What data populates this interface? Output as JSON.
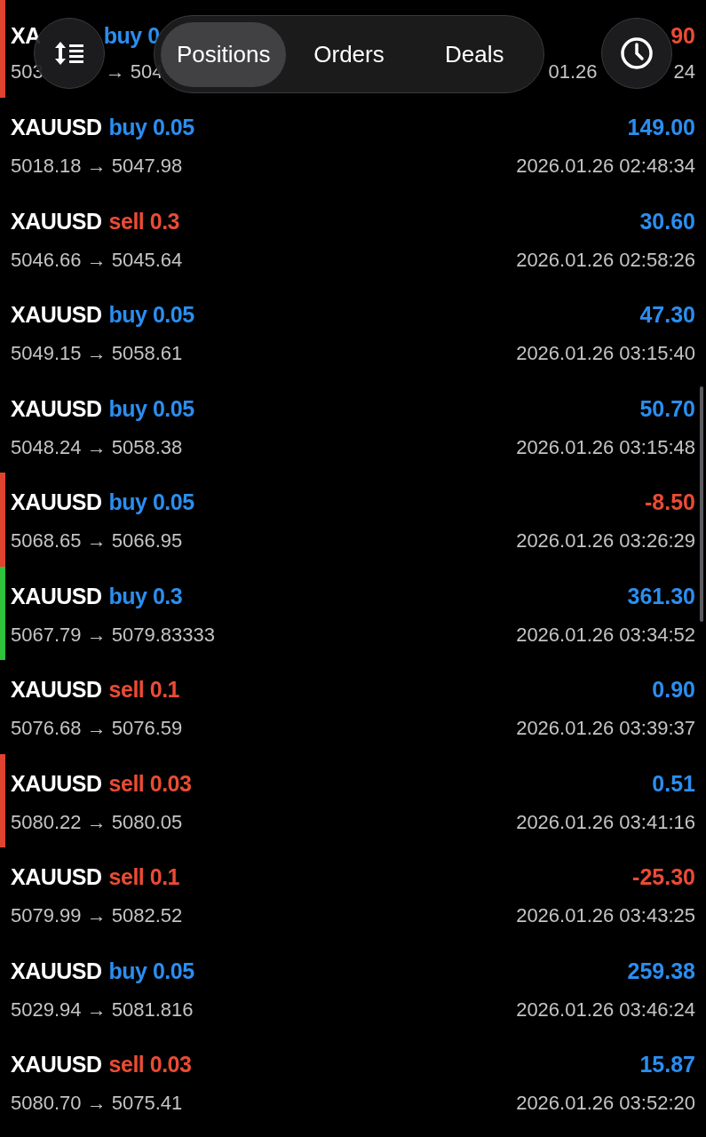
{
  "top_row_partial": {
    "symbol": "XA",
    "side": "buy 0",
    "kind": "buy",
    "profit": "90",
    "negative": true,
    "open_price": "503",
    "close_price": "→ 504",
    "date": "01.26",
    "time": "24",
    "color": "#e0432f"
  },
  "toolbar": {
    "tabs": [
      {
        "label": "Positions",
        "selected": true
      },
      {
        "label": "Orders",
        "selected": false
      },
      {
        "label": "Deals",
        "selected": false
      }
    ]
  },
  "deals": [
    {
      "symbol": "XAUUSD",
      "side": "buy 0.05",
      "kind": "buy",
      "profit": "149.00",
      "negative": false,
      "prices": "5018.18 → 5047.98",
      "time": "2026.01.26 02:48:34"
    },
    {
      "symbol": "XAUUSD",
      "side": "sell 0.3",
      "kind": "sell",
      "profit": "30.60",
      "negative": false,
      "prices": "5046.66 → 5045.64",
      "time": "2026.01.26 02:58:26"
    },
    {
      "symbol": "XAUUSD",
      "side": "buy 0.05",
      "kind": "buy",
      "profit": "47.30",
      "negative": false,
      "prices": "5049.15 → 5058.61",
      "time": "2026.01.26 03:15:40"
    },
    {
      "symbol": "XAUUSD",
      "side": "buy 0.05",
      "kind": "buy",
      "profit": "50.70",
      "negative": false,
      "prices": "5048.24 → 5058.38",
      "time": "2026.01.26 03:15:48"
    },
    {
      "symbol": "XAUUSD",
      "side": "buy 0.05",
      "kind": "buy",
      "profit": "-8.50",
      "negative": true,
      "prices": "5068.65 → 5066.95",
      "time": "2026.01.26 03:26:29",
      "color": "#e0432f"
    },
    {
      "symbol": "XAUUSD",
      "side": "buy 0.3",
      "kind": "buy",
      "profit": "361.30",
      "negative": false,
      "prices": "5067.79 → 5079.83333",
      "time": "2026.01.26 03:34:52",
      "color": "#2fc23a"
    },
    {
      "symbol": "XAUUSD",
      "side": "sell 0.1",
      "kind": "sell",
      "profit": "0.90",
      "negative": false,
      "prices": "5076.68 → 5076.59",
      "time": "2026.01.26 03:39:37"
    },
    {
      "symbol": "XAUUSD",
      "side": "sell 0.03",
      "kind": "sell",
      "profit": "0.51",
      "negative": false,
      "prices": "5080.22 → 5080.05",
      "time": "2026.01.26 03:41:16",
      "color": "#e0432f"
    },
    {
      "symbol": "XAUUSD",
      "side": "sell 0.1",
      "kind": "sell",
      "profit": "-25.30",
      "negative": true,
      "prices": "5079.99 → 5082.52",
      "time": "2026.01.26 03:43:25"
    },
    {
      "symbol": "XAUUSD",
      "side": "buy 0.05",
      "kind": "buy",
      "profit": "259.38",
      "negative": false,
      "prices": "5029.94 → 5081.816",
      "time": "2026.01.26 03:46:24"
    },
    {
      "symbol": "XAUUSD",
      "side": "sell 0.03",
      "kind": "sell",
      "profit": "15.87",
      "negative": false,
      "prices": "5080.70 → 5075.41",
      "time": "2026.01.26 03:52:20"
    }
  ]
}
